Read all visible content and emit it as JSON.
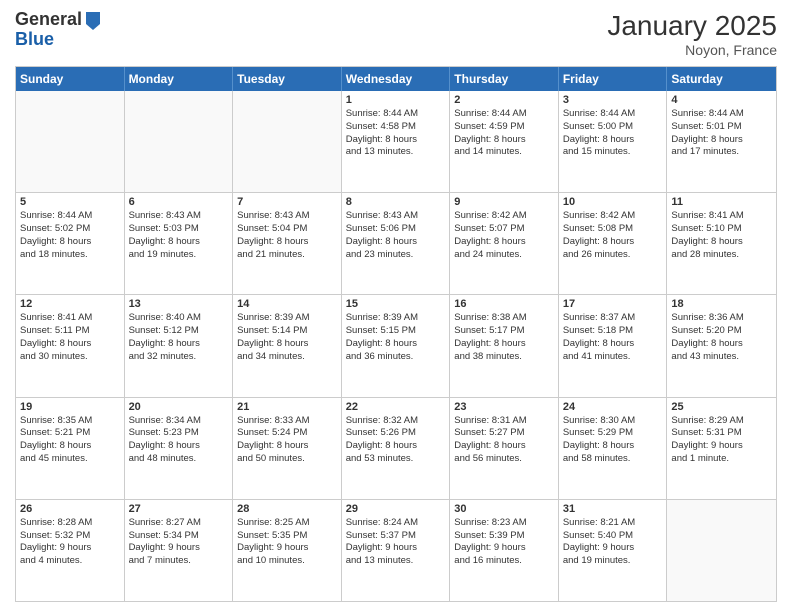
{
  "header": {
    "logo_general": "General",
    "logo_blue": "Blue",
    "month_title": "January 2025",
    "location": "Noyon, France"
  },
  "days_of_week": [
    "Sunday",
    "Monday",
    "Tuesday",
    "Wednesday",
    "Thursday",
    "Friday",
    "Saturday"
  ],
  "rows": [
    [
      {
        "day": "",
        "lines": []
      },
      {
        "day": "",
        "lines": []
      },
      {
        "day": "",
        "lines": []
      },
      {
        "day": "1",
        "lines": [
          "Sunrise: 8:44 AM",
          "Sunset: 4:58 PM",
          "Daylight: 8 hours",
          "and 13 minutes."
        ]
      },
      {
        "day": "2",
        "lines": [
          "Sunrise: 8:44 AM",
          "Sunset: 4:59 PM",
          "Daylight: 8 hours",
          "and 14 minutes."
        ]
      },
      {
        "day": "3",
        "lines": [
          "Sunrise: 8:44 AM",
          "Sunset: 5:00 PM",
          "Daylight: 8 hours",
          "and 15 minutes."
        ]
      },
      {
        "day": "4",
        "lines": [
          "Sunrise: 8:44 AM",
          "Sunset: 5:01 PM",
          "Daylight: 8 hours",
          "and 17 minutes."
        ]
      }
    ],
    [
      {
        "day": "5",
        "lines": [
          "Sunrise: 8:44 AM",
          "Sunset: 5:02 PM",
          "Daylight: 8 hours",
          "and 18 minutes."
        ]
      },
      {
        "day": "6",
        "lines": [
          "Sunrise: 8:43 AM",
          "Sunset: 5:03 PM",
          "Daylight: 8 hours",
          "and 19 minutes."
        ]
      },
      {
        "day": "7",
        "lines": [
          "Sunrise: 8:43 AM",
          "Sunset: 5:04 PM",
          "Daylight: 8 hours",
          "and 21 minutes."
        ]
      },
      {
        "day": "8",
        "lines": [
          "Sunrise: 8:43 AM",
          "Sunset: 5:06 PM",
          "Daylight: 8 hours",
          "and 23 minutes."
        ]
      },
      {
        "day": "9",
        "lines": [
          "Sunrise: 8:42 AM",
          "Sunset: 5:07 PM",
          "Daylight: 8 hours",
          "and 24 minutes."
        ]
      },
      {
        "day": "10",
        "lines": [
          "Sunrise: 8:42 AM",
          "Sunset: 5:08 PM",
          "Daylight: 8 hours",
          "and 26 minutes."
        ]
      },
      {
        "day": "11",
        "lines": [
          "Sunrise: 8:41 AM",
          "Sunset: 5:10 PM",
          "Daylight: 8 hours",
          "and 28 minutes."
        ]
      }
    ],
    [
      {
        "day": "12",
        "lines": [
          "Sunrise: 8:41 AM",
          "Sunset: 5:11 PM",
          "Daylight: 8 hours",
          "and 30 minutes."
        ]
      },
      {
        "day": "13",
        "lines": [
          "Sunrise: 8:40 AM",
          "Sunset: 5:12 PM",
          "Daylight: 8 hours",
          "and 32 minutes."
        ]
      },
      {
        "day": "14",
        "lines": [
          "Sunrise: 8:39 AM",
          "Sunset: 5:14 PM",
          "Daylight: 8 hours",
          "and 34 minutes."
        ]
      },
      {
        "day": "15",
        "lines": [
          "Sunrise: 8:39 AM",
          "Sunset: 5:15 PM",
          "Daylight: 8 hours",
          "and 36 minutes."
        ]
      },
      {
        "day": "16",
        "lines": [
          "Sunrise: 8:38 AM",
          "Sunset: 5:17 PM",
          "Daylight: 8 hours",
          "and 38 minutes."
        ]
      },
      {
        "day": "17",
        "lines": [
          "Sunrise: 8:37 AM",
          "Sunset: 5:18 PM",
          "Daylight: 8 hours",
          "and 41 minutes."
        ]
      },
      {
        "day": "18",
        "lines": [
          "Sunrise: 8:36 AM",
          "Sunset: 5:20 PM",
          "Daylight: 8 hours",
          "and 43 minutes."
        ]
      }
    ],
    [
      {
        "day": "19",
        "lines": [
          "Sunrise: 8:35 AM",
          "Sunset: 5:21 PM",
          "Daylight: 8 hours",
          "and 45 minutes."
        ]
      },
      {
        "day": "20",
        "lines": [
          "Sunrise: 8:34 AM",
          "Sunset: 5:23 PM",
          "Daylight: 8 hours",
          "and 48 minutes."
        ]
      },
      {
        "day": "21",
        "lines": [
          "Sunrise: 8:33 AM",
          "Sunset: 5:24 PM",
          "Daylight: 8 hours",
          "and 50 minutes."
        ]
      },
      {
        "day": "22",
        "lines": [
          "Sunrise: 8:32 AM",
          "Sunset: 5:26 PM",
          "Daylight: 8 hours",
          "and 53 minutes."
        ]
      },
      {
        "day": "23",
        "lines": [
          "Sunrise: 8:31 AM",
          "Sunset: 5:27 PM",
          "Daylight: 8 hours",
          "and 56 minutes."
        ]
      },
      {
        "day": "24",
        "lines": [
          "Sunrise: 8:30 AM",
          "Sunset: 5:29 PM",
          "Daylight: 8 hours",
          "and 58 minutes."
        ]
      },
      {
        "day": "25",
        "lines": [
          "Sunrise: 8:29 AM",
          "Sunset: 5:31 PM",
          "Daylight: 9 hours",
          "and 1 minute."
        ]
      }
    ],
    [
      {
        "day": "26",
        "lines": [
          "Sunrise: 8:28 AM",
          "Sunset: 5:32 PM",
          "Daylight: 9 hours",
          "and 4 minutes."
        ]
      },
      {
        "day": "27",
        "lines": [
          "Sunrise: 8:27 AM",
          "Sunset: 5:34 PM",
          "Daylight: 9 hours",
          "and 7 minutes."
        ]
      },
      {
        "day": "28",
        "lines": [
          "Sunrise: 8:25 AM",
          "Sunset: 5:35 PM",
          "Daylight: 9 hours",
          "and 10 minutes."
        ]
      },
      {
        "day": "29",
        "lines": [
          "Sunrise: 8:24 AM",
          "Sunset: 5:37 PM",
          "Daylight: 9 hours",
          "and 13 minutes."
        ]
      },
      {
        "day": "30",
        "lines": [
          "Sunrise: 8:23 AM",
          "Sunset: 5:39 PM",
          "Daylight: 9 hours",
          "and 16 minutes."
        ]
      },
      {
        "day": "31",
        "lines": [
          "Sunrise: 8:21 AM",
          "Sunset: 5:40 PM",
          "Daylight: 9 hours",
          "and 19 minutes."
        ]
      },
      {
        "day": "",
        "lines": []
      }
    ]
  ]
}
